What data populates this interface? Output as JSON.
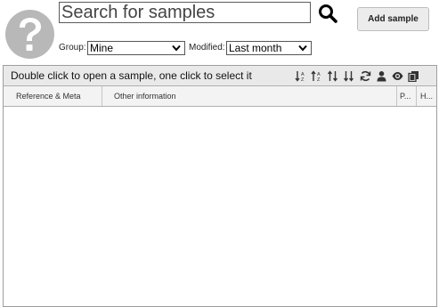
{
  "avatar": {
    "icon": "question-mark-icon",
    "color": "#b8b8b8"
  },
  "search": {
    "placeholder": "Search for samples",
    "value": ""
  },
  "toolbar": {
    "add_label": "Add sample"
  },
  "filters": {
    "group_label": "Group:",
    "group_value": "Mine",
    "modified_label": "Modified:",
    "modified_value": "Last month"
  },
  "panel": {
    "title": "Double click to open a sample, one click to select it",
    "tools": [
      "sort-ascending-icon",
      "sort-descending-icon",
      "sort-up-down-icon",
      "sort-down-up-icon",
      "refresh-icon",
      "user-icon",
      "eye-icon",
      "copy-icon"
    ],
    "columns": [
      {
        "label": "Reference & Meta"
      },
      {
        "label": "Other information"
      },
      {
        "label": "P..."
      },
      {
        "label": "H..."
      }
    ]
  }
}
